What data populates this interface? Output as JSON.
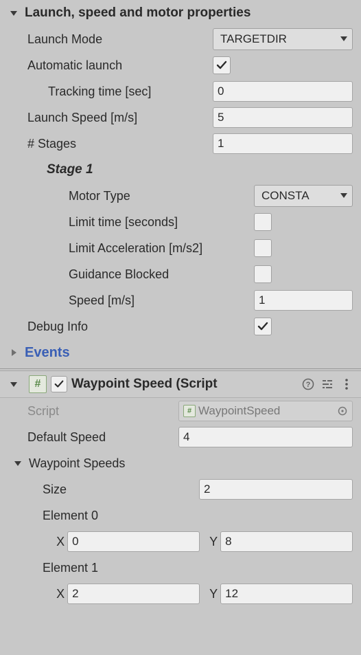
{
  "launch": {
    "header": "Launch, speed and motor properties",
    "mode_label": "Launch Mode",
    "mode_value": "TARGETDIR",
    "auto_label": "Automatic launch",
    "auto_checked": true,
    "tracking_label": "Tracking time [sec]",
    "tracking_value": "0",
    "speed_label": "Launch Speed [m/s]",
    "speed_value": "5",
    "stages_label": "# Stages",
    "stages_value": "1",
    "stage1_header": "Stage 1",
    "stage1": {
      "motor_type_label": "Motor Type",
      "motor_type_value": "CONSTA",
      "limit_time_label": "Limit time [seconds]",
      "limit_time_checked": false,
      "limit_accel_label": "Limit Acceleration [m/s2]",
      "limit_accel_checked": false,
      "guidance_label": "Guidance Blocked",
      "guidance_checked": false,
      "speed_label": "Speed [m/s]",
      "speed_value": "1"
    },
    "debug_label": "Debug Info",
    "debug_checked": true,
    "events_label": "Events"
  },
  "waypoint": {
    "title": "Waypoint Speed (Script",
    "enabled": true,
    "script_label": "Script",
    "script_value": "WaypointSpeed",
    "default_speed_label": "Default Speed",
    "default_speed_value": "4",
    "speeds_header": "Waypoint Speeds",
    "size_label": "Size",
    "size_value": "2",
    "element0_label": "Element 0",
    "element0": {
      "x_label": "X",
      "x": "0",
      "y_label": "Y",
      "y": "8"
    },
    "element1_label": "Element 1",
    "element1": {
      "x_label": "X",
      "x": "2",
      "y_label": "Y",
      "y": "12"
    }
  }
}
